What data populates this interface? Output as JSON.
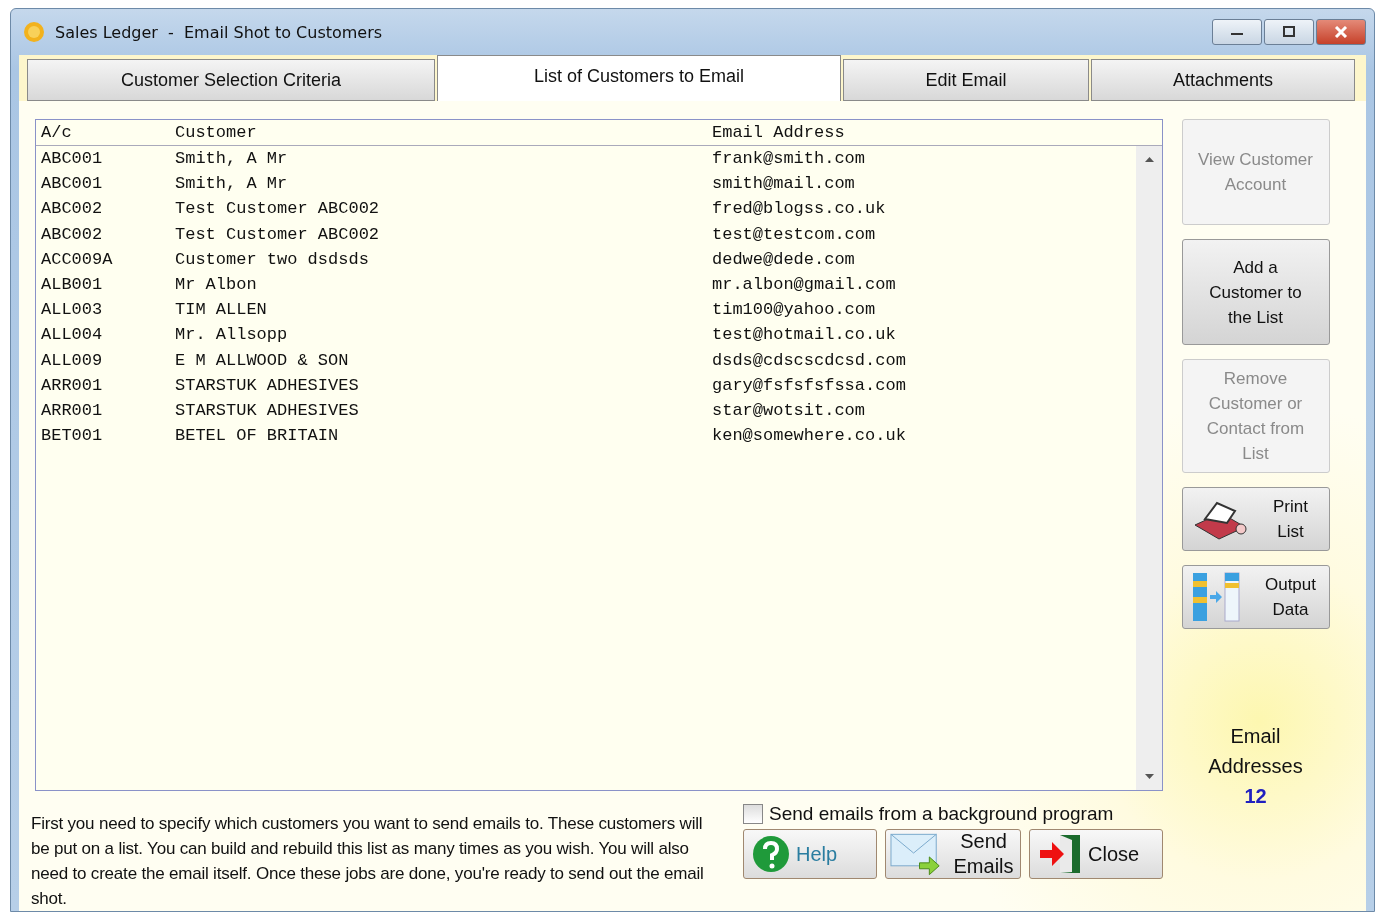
{
  "window": {
    "title": "Sales Ledger  -  Email Shot to Customers"
  },
  "tabs": [
    {
      "label": "Customer Selection Criteria",
      "selected": false
    },
    {
      "label": "List of Customers to Email",
      "selected": true
    },
    {
      "label": "Edit Email",
      "selected": false
    },
    {
      "label": "Attachments",
      "selected": false
    }
  ],
  "table": {
    "columns": [
      "A/c",
      "Customer",
      "Email Address"
    ],
    "rows": [
      [
        "ABC001",
        "Smith, A Mr",
        "frank@smith.com"
      ],
      [
        "ABC001",
        "Smith, A Mr",
        "smith@mail.com"
      ],
      [
        "ABC002",
        "Test Customer ABC002",
        "fred@blogss.co.uk"
      ],
      [
        "ABC002",
        "Test Customer ABC002",
        "test@testcom.com"
      ],
      [
        "ACC009A",
        "Customer two dsdsds",
        "dedwe@dede.com"
      ],
      [
        "ALB001",
        "Mr Albon",
        "mr.albon@gmail.com"
      ],
      [
        "ALL003",
        "TIM ALLEN",
        "tim100@yahoo.com"
      ],
      [
        "ALL004",
        "Mr. Allsopp",
        "test@hotmail.co.uk"
      ],
      [
        "ALL009",
        "E M ALLWOOD & SON",
        "dsds@cdscscdcsd.com"
      ],
      [
        "ARR001",
        "STARSTUK ADHESIVES",
        "gary@fsfsfsfssa.com"
      ],
      [
        "ARR001",
        "STARSTUK ADHESIVES",
        "star@wotsit.com"
      ],
      [
        "BET001",
        "BETEL OF BRITAIN",
        "ken@somewhere.co.uk"
      ]
    ]
  },
  "side_buttons": [
    {
      "kind": "text",
      "label": "View Customer Account",
      "disabled": true
    },
    {
      "kind": "text",
      "label": "Add a Customer to the List",
      "disabled": false
    },
    {
      "kind": "text",
      "label": "Remove Customer or Contact from List",
      "disabled": true
    },
    {
      "kind": "print",
      "label": "Print List",
      "disabled": false
    },
    {
      "kind": "output",
      "label": "Output Data",
      "disabled": false
    }
  ],
  "email_count": {
    "label_1": "Email",
    "label_2": "Addresses",
    "value": "12"
  },
  "info_text": "First you need to specify which customers you want to send emails to.  These customers will be put on a list.  You can build and rebuild this list as many times as you wish.  You will also need to create the email itself.  Once these jobs are done, you're ready to send out the email shot.",
  "background_option": {
    "label": "Send emails from a background program",
    "checked": false
  },
  "buttons": [
    {
      "kind": "help",
      "label": "Help"
    },
    {
      "kind": "send",
      "label": "Send Emails"
    },
    {
      "kind": "close",
      "label": "Close"
    }
  ]
}
